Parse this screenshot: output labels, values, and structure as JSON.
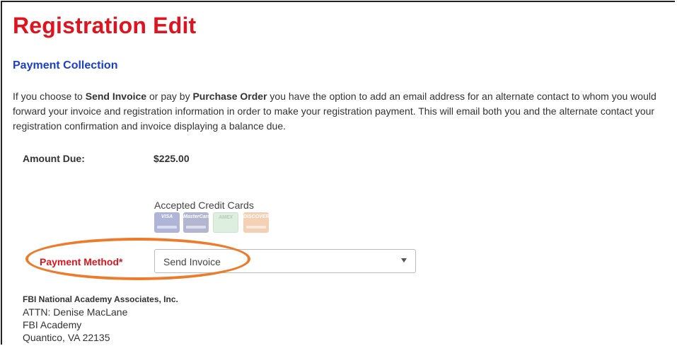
{
  "page": {
    "title": "Registration Edit",
    "section_title": "Payment Collection"
  },
  "intro": {
    "part1": "If you choose to ",
    "bold1": "Send Invoice",
    "part2": " or pay by ",
    "bold2": "Purchase Order",
    "part3": " you have the option to add an email address for an alternate contact to whom you would forward your invoice and registration information in order to make your registration payment.  This will email both you and the alternate contact your registration confirmation and invoice displaying a balance due."
  },
  "amount": {
    "label": "Amount Due:",
    "value": "$225.00"
  },
  "cards": {
    "title": "Accepted Credit Cards",
    "items": [
      {
        "name": "VISA",
        "icon": "visa-card-icon",
        "color": "#1a2f8c"
      },
      {
        "name": "MasterCard",
        "icon": "mastercard-icon",
        "color": "#27317a"
      },
      {
        "name": "AMEX",
        "icon": "amex-card-icon",
        "color": "#9fd6a8"
      },
      {
        "name": "DISCOVER",
        "icon": "discover-card-icon",
        "color": "#e07a2a"
      }
    ]
  },
  "payment_method": {
    "label": "Payment Method*",
    "selected": "Send Invoice",
    "highlight_color": "#ee7b2b"
  },
  "address": {
    "org": "FBI National Academy Associates, Inc.",
    "line1": "ATTN:  Denise MacLane",
    "line2": "FBI Academy",
    "line3": "Quantico, VA 22135"
  },
  "colors": {
    "title_red": "#e0141e",
    "section_blue": "#1a3fc9",
    "text": "#333333"
  }
}
